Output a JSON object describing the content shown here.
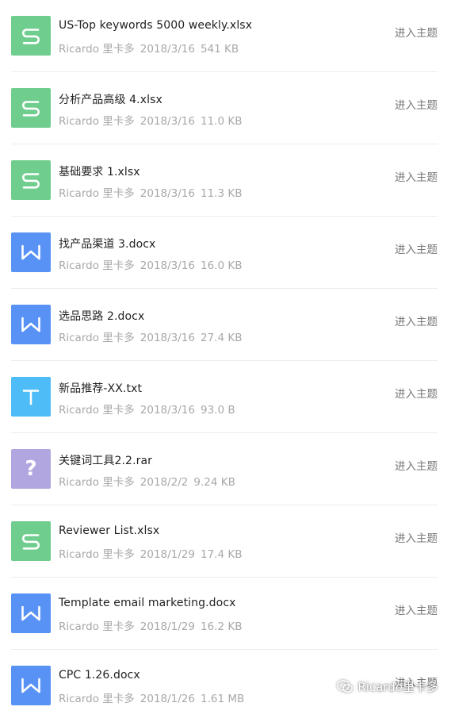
{
  "colors": {
    "xlsx": "#6fcd8e",
    "docx": "#5892f5",
    "txt": "#4dbcf7",
    "rar": "#b2a6e0"
  },
  "action_label": "进入主题",
  "files": [
    {
      "name": "US-Top keywords 5000 weekly.xlsx",
      "type": "xlsx",
      "icon": "spreadsheet-icon",
      "author": "Ricardo 里卡多",
      "date": "2018/3/16",
      "size": "541 KB"
    },
    {
      "name": "分析产品高级 4.xlsx",
      "type": "xlsx",
      "icon": "spreadsheet-icon",
      "author": "Ricardo 里卡多",
      "date": "2018/3/16",
      "size": "11.0 KB"
    },
    {
      "name": "基础要求 1.xlsx",
      "type": "xlsx",
      "icon": "spreadsheet-icon",
      "author": "Ricardo 里卡多",
      "date": "2018/3/16",
      "size": "11.3 KB"
    },
    {
      "name": "找产品渠道 3.docx",
      "type": "docx",
      "icon": "word-document-icon",
      "author": "Ricardo 里卡多",
      "date": "2018/3/16",
      "size": "16.0 KB"
    },
    {
      "name": "选品思路 2.docx",
      "type": "docx",
      "icon": "word-document-icon",
      "author": "Ricardo 里卡多",
      "date": "2018/3/16",
      "size": "27.4 KB"
    },
    {
      "name": "新品推荐-XX.txt",
      "type": "txt",
      "icon": "text-file-icon",
      "author": "Ricardo 里卡多",
      "date": "2018/3/16",
      "size": "93.0 B"
    },
    {
      "name": "关键词工具2.2.rar",
      "type": "rar",
      "icon": "unknown-file-icon",
      "author": "Ricardo 里卡多",
      "date": "2018/2/2",
      "size": "9.24 KB"
    },
    {
      "name": "Reviewer List.xlsx",
      "type": "xlsx",
      "icon": "spreadsheet-icon",
      "author": "Ricardo 里卡多",
      "date": "2018/1/29",
      "size": "17.4 KB"
    },
    {
      "name": "Template email marketing.docx",
      "type": "docx",
      "icon": "word-document-icon",
      "author": "Ricardo 里卡多",
      "date": "2018/1/29",
      "size": "16.2 KB"
    },
    {
      "name": "CPC 1.26.docx",
      "type": "docx",
      "icon": "word-document-icon",
      "author": "Ricardo 里卡多",
      "date": "2018/1/26",
      "size": "1.61 MB"
    }
  ],
  "watermark": {
    "text": "Ricardo里卡多",
    "icon": "wechat-icon"
  }
}
